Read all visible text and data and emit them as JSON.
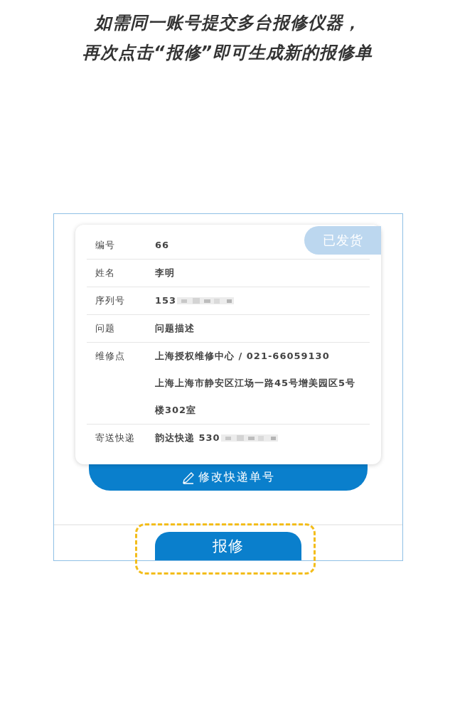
{
  "caption": {
    "line_1": "如需同一账号提交多台报修仪器，",
    "line_2": "再次点击“*报修*”即可生成新的报修单"
  },
  "card": {
    "status_badge": "已发货",
    "rows": [
      {
        "label": "编号",
        "values": [
          "66"
        ],
        "redacted": false
      },
      {
        "label": "姓名",
        "values": [
          "李明"
        ],
        "redacted": false
      },
      {
        "label": "序列号",
        "values": [
          "153"
        ],
        "redacted": true
      },
      {
        "label": "问题",
        "values": [
          "问题描述"
        ],
        "redacted": false
      },
      {
        "label": "维修点",
        "values": [
          "上海授权维修中心 / 021-66059130",
          "上海上海市静安区江场一路45号增美园区5号楼302室"
        ],
        "redacted": false
      },
      {
        "label": "寄送快递",
        "values": [
          "韵达快递 530"
        ],
        "redacted": true
      }
    ]
  },
  "edit_button": "修改快递单号",
  "repair_button": {
    "label": "报修",
    "highlighted": true
  }
}
